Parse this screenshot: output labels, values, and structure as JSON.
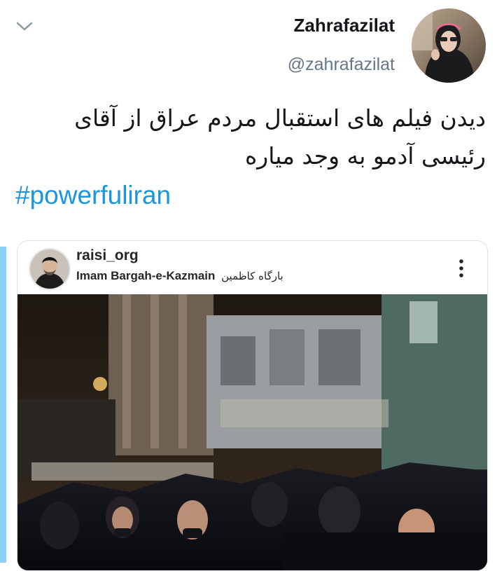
{
  "tweet": {
    "author_name": "Zahrafazilat",
    "author_handle": "@zahrafazilat",
    "text_line1": "دیدن فیلم های استقبال مردم عراق از آقای",
    "text_line2": "رئیسی آدمو به وجد میاره",
    "hashtag": "#powerfuliran"
  },
  "embed": {
    "username": "raisi_org",
    "location_en": "Imam Bargah-e-Kazmain",
    "location_fa": "بارگاه کاظمین"
  },
  "icons": {
    "caret": "chevron-down-icon",
    "more": "more-vertical-icon"
  },
  "colors": {
    "link": "#1b95e0",
    "handle": "#657786",
    "thread_bar": "#8fd1f6"
  }
}
